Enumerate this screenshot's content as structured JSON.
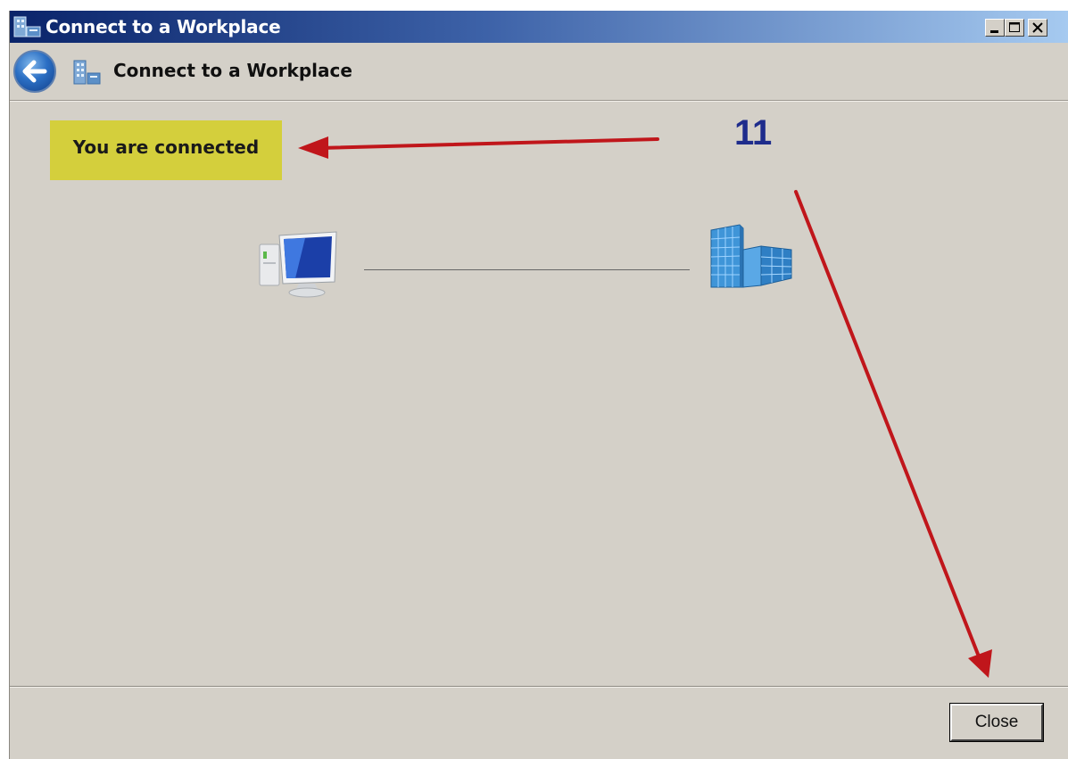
{
  "window": {
    "title": "Connect to a Workplace",
    "title_icon": "workplace-building-icon",
    "buttons": [
      "minimize",
      "maximize",
      "close"
    ]
  },
  "header": {
    "back_icon": "back-arrow-icon",
    "icon": "workplace-building-icon",
    "title": "Connect to a Workplace"
  },
  "main": {
    "status_message": "You are connected",
    "status_highlight_color": "#d4cf3c",
    "client_icon": "computer-icon",
    "server_icon": "office-building-icon"
  },
  "annotation": {
    "step_number": "11",
    "step_color": "#1e2c8c",
    "arrow_color": "#c0161b"
  },
  "footer": {
    "close_label": "Close"
  }
}
